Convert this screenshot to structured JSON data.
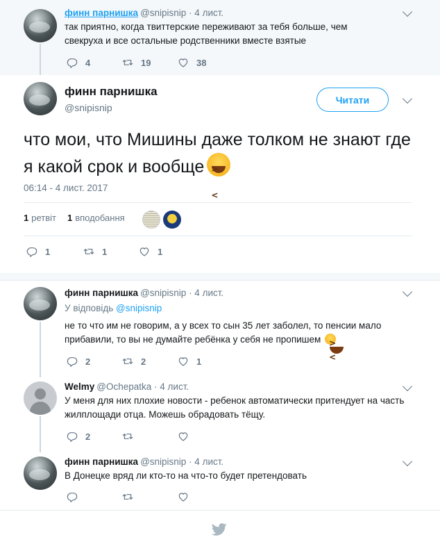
{
  "ancestor_tweet": {
    "name": "финн парнишка",
    "handle": "@snipisnip",
    "date": "· 4 лист.",
    "text": "так приятно, когда твиттерские переживают за тебя больше, чем свекруха и все остальные родственники вместе взятые",
    "replies": "4",
    "retweets": "19",
    "likes": "38"
  },
  "main_tweet": {
    "name": "финн парнишка",
    "handle": "@snipisnip",
    "follow_label": "Читати",
    "text": "что мои, что Мишины даже толком не знают где я какой срок  и вообще",
    "emoji_icon": "laughing-face-emoji",
    "date": "06:14 - 4 лист. 2017",
    "retweet_count": "1",
    "retweet_label": "ретвіт",
    "like_count": "1",
    "like_label": "вподобання",
    "replies": "1",
    "retweets": "1",
    "likes": "1"
  },
  "replies": [
    {
      "name": "финн парнишка",
      "handle": "@snipisnip",
      "date": "· 4 лист.",
      "reply_to_prefix": "У відповідь",
      "reply_to_user": "@snipisnip",
      "text": "не то что им не говорим, а у всех то сын 35 лет заболел, то пенсии мало прибавили, то вы не думайте ребёнка у себя не пропишем",
      "replies": "2",
      "retweets": "2",
      "likes": "1"
    },
    {
      "name": "Welmy",
      "handle": "@Ochepatka",
      "date": "· 4 лист.",
      "text": "У меня для них плохие новости - ребенок автоматически притендует на часть жилплощади отца. Можешь обрадовать тёщу.",
      "replies": "2",
      "retweets": "",
      "likes": ""
    },
    {
      "name": "финн парнишка",
      "handle": "@snipisnip",
      "date": "· 4 лист.",
      "text": "В Донецке вряд ли кто-то на что-то будет претендовать",
      "replies": "",
      "retweets": "",
      "likes": ""
    }
  ],
  "colors": {
    "accent": "#1da1f2",
    "secondary_text": "#657786",
    "background_alt": "#f5f8fa",
    "divider": "#e6ecf0"
  }
}
